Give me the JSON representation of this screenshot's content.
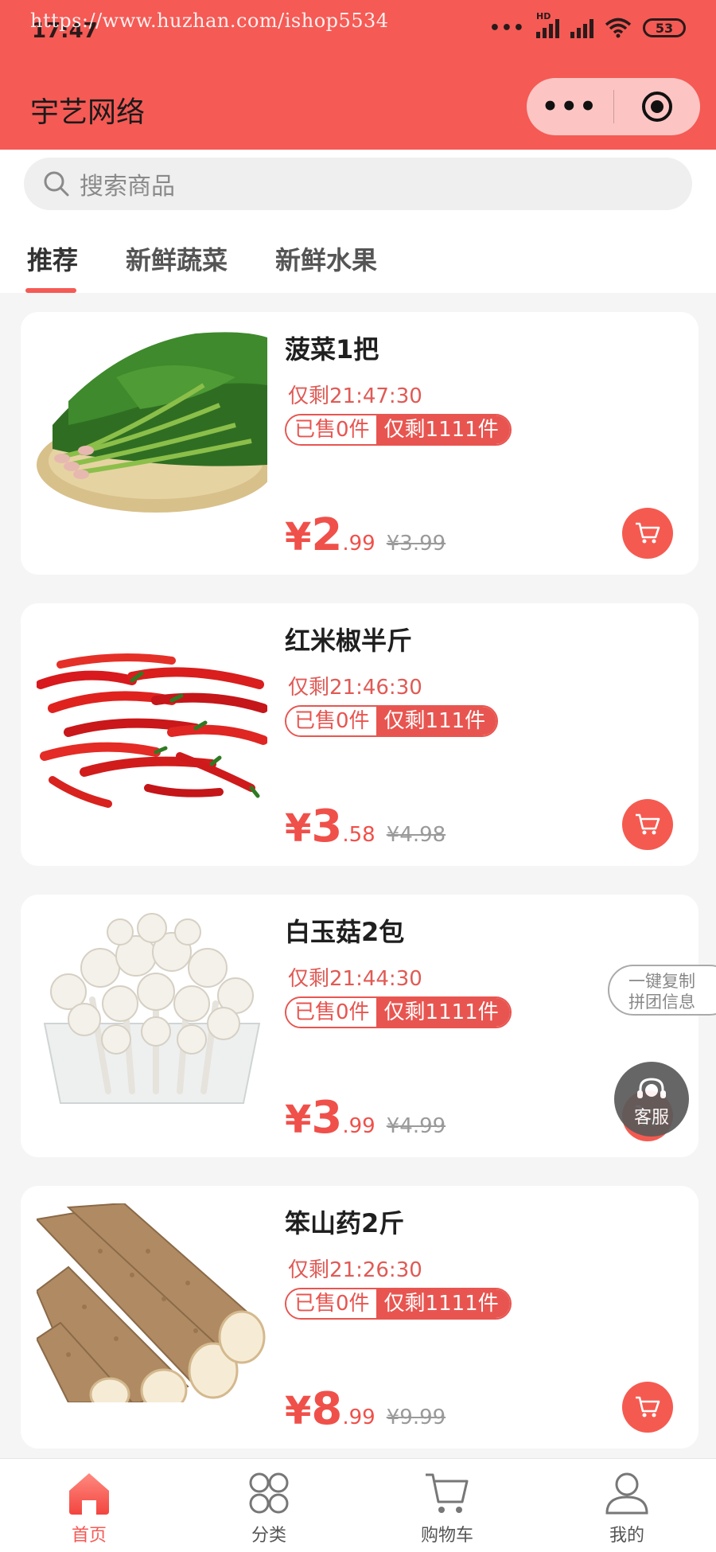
{
  "watermark": "https://www.huzhan.com/ishop5534",
  "status_bar": {
    "time": "17:47",
    "network": "HD",
    "battery": "53"
  },
  "header": {
    "title": "宇艺网络",
    "more_label": "•••"
  },
  "search": {
    "placeholder": "搜索商品"
  },
  "tabs": [
    {
      "label": "推荐",
      "active": true
    },
    {
      "label": "新鲜蔬菜",
      "active": false
    },
    {
      "label": "新鲜水果",
      "active": false
    }
  ],
  "products": [
    {
      "name": "菠菜1把",
      "timer": "仅剩21:47:30",
      "sold": "已售0件",
      "stock": "仅剩1111件",
      "currency": "¥",
      "price_int": "2",
      "price_dec": ".99",
      "orig": "¥3.99",
      "image": "spinach"
    },
    {
      "name": "红米椒半斤",
      "timer": "仅剩21:46:30",
      "sold": "已售0件",
      "stock": "仅剩111件",
      "currency": "¥",
      "price_int": "3",
      "price_dec": ".58",
      "orig": "¥4.98",
      "image": "chili"
    },
    {
      "name": "白玉菇2包",
      "timer": "仅剩21:44:30",
      "sold": "已售0件",
      "stock": "仅剩1111件",
      "currency": "¥",
      "price_int": "3",
      "price_dec": ".99",
      "orig": "¥4.99",
      "image": "mushroom"
    },
    {
      "name": "笨山药2斤",
      "timer": "仅剩21:26:30",
      "sold": "已售0件",
      "stock": "仅剩1111件",
      "currency": "¥",
      "price_int": "8",
      "price_dec": ".99",
      "orig": "¥9.99",
      "image": "yam"
    }
  ],
  "floating": {
    "copy_line1": "一键复制",
    "copy_line2": "拼团信息",
    "service": "客服"
  },
  "bottom_nav": [
    {
      "label": "首页",
      "icon": "home-icon",
      "active": true
    },
    {
      "label": "分类",
      "icon": "category-icon",
      "active": false
    },
    {
      "label": "购物车",
      "icon": "cart-icon",
      "active": false
    },
    {
      "label": "我的",
      "icon": "user-icon",
      "active": false
    }
  ],
  "colors": {
    "brand": "#f55a55",
    "price": "#f0504a",
    "muted": "#9a9a9a"
  }
}
